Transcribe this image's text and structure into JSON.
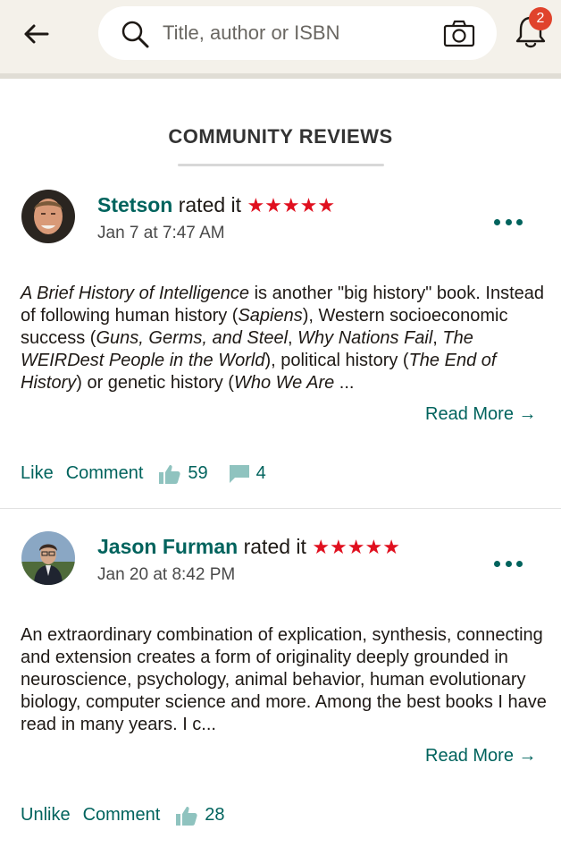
{
  "topbar": {
    "search_placeholder": "Title, author or ISBN",
    "notification_count": "2",
    "back_icon": "arrow-left-icon",
    "search_icon": "search-icon",
    "camera_icon": "camera-icon",
    "bell_icon": "bell-icon"
  },
  "section": {
    "title": "COMMUNITY REVIEWS"
  },
  "colors": {
    "brand": "#00635d",
    "star": "#e0101f",
    "badge": "#e0432c",
    "topbar_bg": "#f4f1ea"
  },
  "reviews": [
    {
      "reviewer": "Stetson",
      "rated_text": "rated it",
      "stars": "★★★★★",
      "rating": 5,
      "date": "Jan 7 at 7:47 AM",
      "body": {
        "t1": "A Brief History of Intelligence",
        "t2": " is another \"big history\" book. Instead of following human history (",
        "t3": "Sapiens",
        "t4": "), Western socioeconomic success (",
        "t5": "Guns, Germs, and Steel",
        "t6": ", ",
        "t7": "Why Nations Fail",
        "t8": ", ",
        "t9": "The WEIRDest People in the World",
        "t10": "), political history (",
        "t11": "The End of History",
        "t12": ") or genetic history (",
        "t13": "Who We Are",
        "t14": " ..."
      },
      "read_more": "Read More →",
      "like_label": "Like",
      "comment_label": "Comment",
      "likes": "59",
      "comments": "4"
    },
    {
      "reviewer": "Jason Furman",
      "rated_text": "rated it",
      "stars": "★★★★★",
      "rating": 5,
      "date": "Jan 20 at 8:42 PM",
      "body_text": "An extraordinary combination of explication, synthesis, connecting and extension creates a form of originality deeply grounded in neuroscience, psychology, animal behavior, human evolutionary biology, computer science and more. Among the best books I have read in many years. I c...",
      "read_more": "Read More →",
      "like_label": "Unlike",
      "comment_label": "Comment",
      "likes": "28"
    }
  ]
}
